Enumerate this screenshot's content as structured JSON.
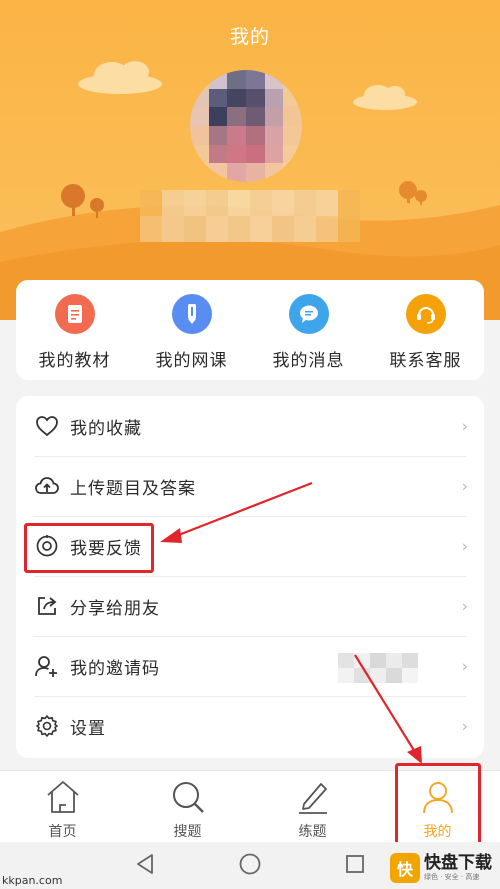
{
  "header": {
    "title": "我的"
  },
  "quick_actions": [
    {
      "label": "我的教材",
      "icon": "book-icon",
      "color": "#f06b4f"
    },
    {
      "label": "我的网课",
      "icon": "pencil-icon",
      "color": "#5a8df2"
    },
    {
      "label": "我的消息",
      "icon": "message-icon",
      "color": "#3fa5ea"
    },
    {
      "label": "联系客服",
      "icon": "headset-icon",
      "color": "#f5a10a"
    }
  ],
  "menu": [
    {
      "label": "我的收藏",
      "icon": "heart-icon"
    },
    {
      "label": "上传题目及答案",
      "icon": "cloud-upload-icon"
    },
    {
      "label": "我要反馈",
      "icon": "feedback-icon"
    },
    {
      "label": "分享给朋友",
      "icon": "share-icon"
    },
    {
      "label": "我的邀请码",
      "icon": "add-user-icon"
    },
    {
      "label": "设置",
      "icon": "gear-icon"
    }
  ],
  "tabbar": [
    {
      "label": "首页",
      "icon": "home-icon",
      "active": false
    },
    {
      "label": "搜题",
      "icon": "search-icon",
      "active": false
    },
    {
      "label": "练题",
      "icon": "edit-icon",
      "active": false
    },
    {
      "label": "我的",
      "icon": "user-icon",
      "active": true
    }
  ],
  "colors": {
    "header": "#fbb445",
    "accent": "#f5a623",
    "annotation": "#e0252b"
  },
  "watermark": {
    "left": "kkpan.com",
    "brand": "快盘下载",
    "brand_logo": "快",
    "brand_sub": "绿色 · 安全 · 高速"
  }
}
